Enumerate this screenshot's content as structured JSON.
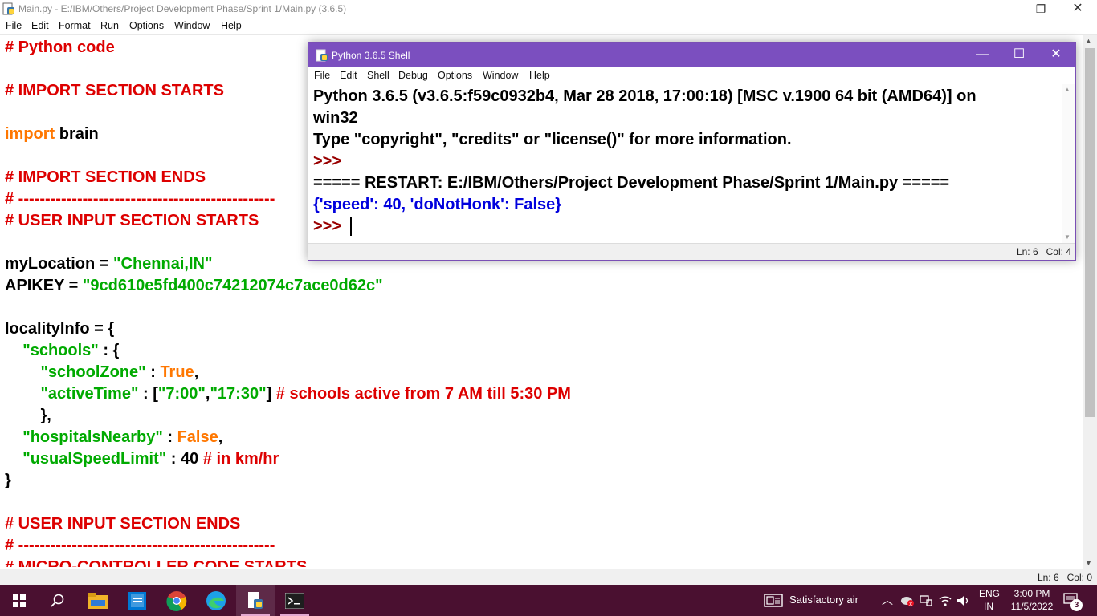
{
  "main_window": {
    "title": "Main.py - E:/IBM/Others/Project Development Phase/Sprint 1/Main.py (3.6.5)",
    "menu": [
      "File",
      "Edit",
      "Format",
      "Run",
      "Options",
      "Window",
      "Help"
    ],
    "status": "Ln: 6   Col: 0",
    "code_lines": [
      [
        {
          "t": "# Python code",
          "c": "comment"
        }
      ],
      [],
      [
        {
          "t": "# IMPORT SECTION STARTS",
          "c": "comment"
        }
      ],
      [],
      [
        {
          "t": "import",
          "c": "keyword"
        },
        {
          "t": " brain",
          "c": "normal"
        }
      ],
      [],
      [
        {
          "t": "# IMPORT SECTION ENDS",
          "c": "comment"
        }
      ],
      [
        {
          "t": "# ------------------------------------------------",
          "c": "comment"
        }
      ],
      [
        {
          "t": "# USER INPUT SECTION STARTS",
          "c": "comment"
        }
      ],
      [],
      [
        {
          "t": "myLocation = ",
          "c": "normal"
        },
        {
          "t": "\"Chennai,IN\"",
          "c": "string"
        }
      ],
      [
        {
          "t": "APIKEY = ",
          "c": "normal"
        },
        {
          "t": "\"9cd610e5fd400c74212074c7ace0d62c\"",
          "c": "string"
        }
      ],
      [],
      [
        {
          "t": "localityInfo = {",
          "c": "normal"
        }
      ],
      [
        {
          "t": "    ",
          "c": "normal"
        },
        {
          "t": "\"schools\"",
          "c": "string"
        },
        {
          "t": " : {",
          "c": "normal"
        }
      ],
      [
        {
          "t": "        ",
          "c": "normal"
        },
        {
          "t": "\"schoolZone\"",
          "c": "string"
        },
        {
          "t": " : ",
          "c": "normal"
        },
        {
          "t": "True",
          "c": "keyword"
        },
        {
          "t": ",",
          "c": "normal"
        }
      ],
      [
        {
          "t": "        ",
          "c": "normal"
        },
        {
          "t": "\"activeTime\"",
          "c": "string"
        },
        {
          "t": " : [",
          "c": "normal"
        },
        {
          "t": "\"7:00\"",
          "c": "string"
        },
        {
          "t": ",",
          "c": "normal"
        },
        {
          "t": "\"17:30\"",
          "c": "string"
        },
        {
          "t": "] ",
          "c": "normal"
        },
        {
          "t": "# schools active from 7 AM till 5:30 PM",
          "c": "comment"
        }
      ],
      [
        {
          "t": "        },",
          "c": "normal"
        }
      ],
      [
        {
          "t": "    ",
          "c": "normal"
        },
        {
          "t": "\"hospitalsNearby\"",
          "c": "string"
        },
        {
          "t": " : ",
          "c": "normal"
        },
        {
          "t": "False",
          "c": "keyword"
        },
        {
          "t": ",",
          "c": "normal"
        }
      ],
      [
        {
          "t": "    ",
          "c": "normal"
        },
        {
          "t": "\"usualSpeedLimit\"",
          "c": "string"
        },
        {
          "t": " : 40 ",
          "c": "normal"
        },
        {
          "t": "# in km/hr",
          "c": "comment"
        }
      ],
      [
        {
          "t": "}",
          "c": "normal"
        }
      ],
      [],
      [
        {
          "t": "# USER INPUT SECTION ENDS",
          "c": "comment"
        }
      ],
      [
        {
          "t": "# ------------------------------------------------",
          "c": "comment"
        }
      ],
      [
        {
          "t": "# MICRO-CONTROLLER CODE STARTS",
          "c": "comment"
        }
      ]
    ]
  },
  "shell_window": {
    "title": "Python 3.6.5 Shell",
    "menu": [
      "File",
      "Edit",
      "Shell",
      "Debug",
      "Options",
      "Window",
      "Help"
    ],
    "status": "Ln: 6   Col: 4",
    "lines": [
      {
        "t": "Python 3.6.5 (v3.6.5:f59c0932b4, Mar 28 2018, 17:00:18) [MSC v.1900 64 bit (AMD64)] on",
        "c": "black"
      },
      {
        "t": "win32",
        "c": "black"
      },
      {
        "t": "Type \"copyright\", \"credits\" or \"license()\" for more information.",
        "c": "black"
      },
      {
        "t": ">>> ",
        "c": "prompt"
      },
      {
        "t": "===== RESTART: E:/IBM/Others/Project Development Phase/Sprint 1/Main.py =====",
        "c": "black"
      },
      {
        "t": "{'speed': 40, 'doNotHonk': False}",
        "c": "blue"
      },
      {
        "t": ">>> ",
        "c": "prompt"
      }
    ]
  },
  "taskbar": {
    "weather": "Satisfactory air",
    "lang_top": "ENG",
    "lang_bottom": "IN",
    "time": "3:00 PM",
    "date": "11/5/2022",
    "notification_count": "3",
    "apps": [
      "start-icon",
      "search-icon",
      "file-explorer-icon",
      "store-icon",
      "chrome-icon",
      "edge-icon",
      "idle-icon",
      "terminal-icon"
    ]
  },
  "colors": {
    "comment": "#dd0000",
    "keyword": "#ff7700",
    "string": "#00aa00",
    "shell_title_bar": "#7b4fbf",
    "taskbar": "#4a1030"
  }
}
